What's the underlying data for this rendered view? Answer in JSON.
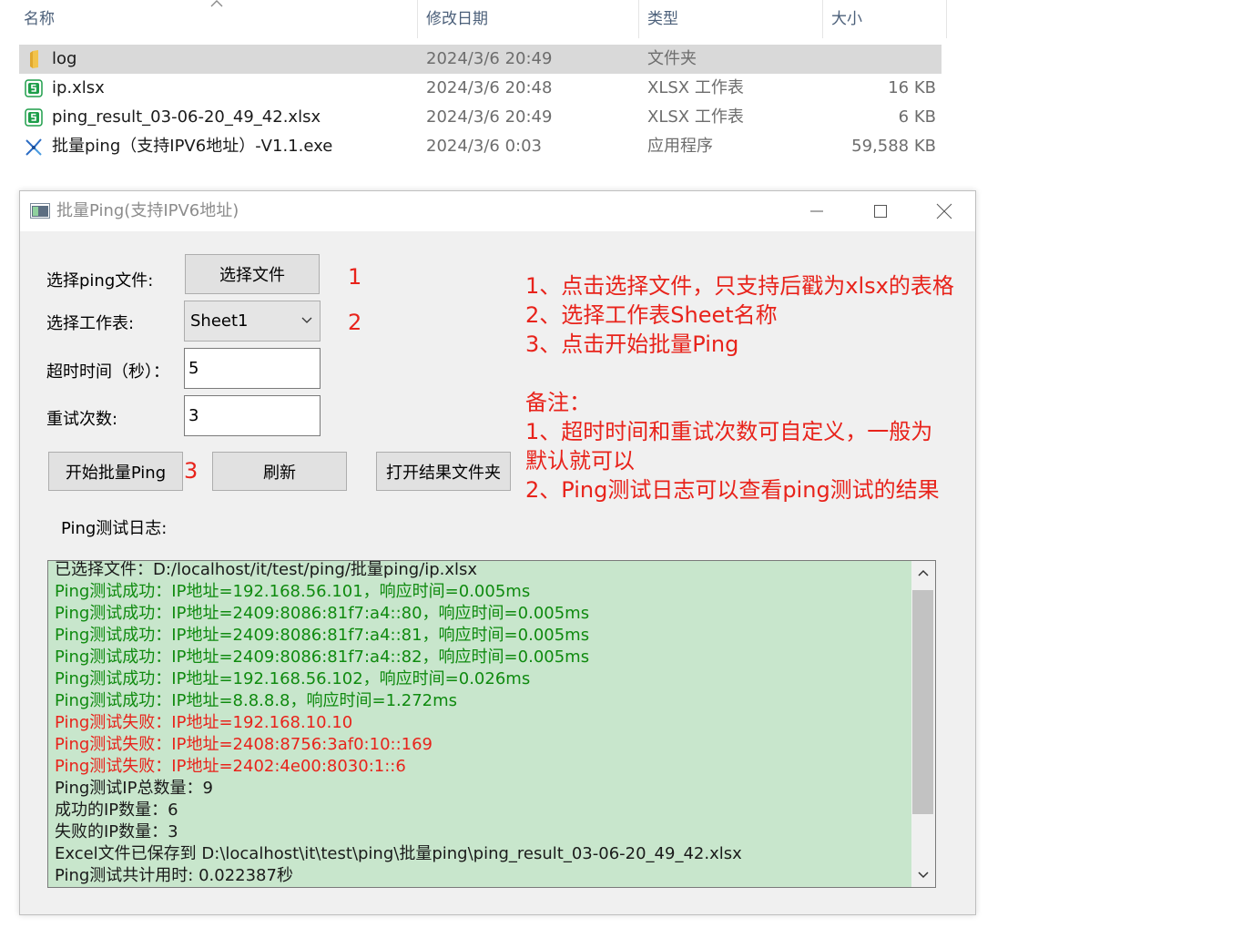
{
  "explorer": {
    "columns": {
      "name": "名称",
      "date": "修改日期",
      "type": "类型",
      "size": "大小"
    },
    "files": [
      {
        "icon": "folder-icon",
        "name": "log",
        "date": "2024/3/6 20:49",
        "type": "文件夹",
        "size": "",
        "selected": true
      },
      {
        "icon": "spreadsheet-icon",
        "name": "ip.xlsx",
        "date": "2024/3/6 20:48",
        "type": "XLSX 工作表",
        "size": "16 KB"
      },
      {
        "icon": "spreadsheet-icon",
        "name": "ping_result_03-06-20_49_42.xlsx",
        "date": "2024/3/6 20:49",
        "type": "XLSX 工作表",
        "size": "6 KB"
      },
      {
        "icon": "exe-icon",
        "name": "批量ping（支持IPV6地址）-V1.1.exe",
        "date": "2024/3/6 0:03",
        "type": "应用程序",
        "size": "59,588 KB"
      }
    ]
  },
  "window": {
    "title": "批量Ping(支持IPV6地址)",
    "select_file_label": "选择ping文件:",
    "select_file_button": "选择文件",
    "select_sheet_label": "选择工作表:",
    "sheet_value": "Sheet1",
    "timeout_label": "超时时间（秒）：",
    "timeout_value": "5",
    "retry_label": "重试次数:",
    "retry_value": "3",
    "start_button": "开始批量Ping",
    "refresh_button": "刷新",
    "open_folder_button": "打开结果文件夹",
    "log_label": "Ping测试日志:",
    "step_numbers": [
      "1",
      "2",
      "3"
    ]
  },
  "notes": [
    "1、点击选择文件，只支持后戳为xlsx的表格",
    "2、选择工作表Sheet名称",
    "3、点击开始批量Ping",
    "",
    "备注：",
    "1、超时时间和重试次数可自定义，一般为",
    "默认就可以",
    "2、Ping测试日志可以查看ping测试的结果"
  ],
  "log": [
    {
      "text": "已选择文件：D:/localhost/it/test/ping/批量ping/ip.xlsx",
      "status": "info"
    },
    {
      "text": "Ping测试成功：IP地址=192.168.56.101，响应时间=0.005ms",
      "status": "success"
    },
    {
      "text": "Ping测试成功：IP地址=2409:8086:81f7:a4::80，响应时间=0.005ms",
      "status": "success"
    },
    {
      "text": "Ping测试成功：IP地址=2409:8086:81f7:a4::81，响应时间=0.005ms",
      "status": "success"
    },
    {
      "text": "Ping测试成功：IP地址=2409:8086:81f7:a4::82，响应时间=0.005ms",
      "status": "success"
    },
    {
      "text": "Ping测试成功：IP地址=192.168.56.102，响应时间=0.026ms",
      "status": "success"
    },
    {
      "text": "Ping测试成功：IP地址=8.8.8.8，响应时间=1.272ms",
      "status": "success"
    },
    {
      "text": "Ping测试失败：IP地址=192.168.10.10",
      "status": "fail"
    },
    {
      "text": "Ping测试失败：IP地址=2408:8756:3af0:10::169",
      "status": "fail"
    },
    {
      "text": "Ping测试失败：IP地址=2402:4e00:8030:1::6",
      "status": "fail"
    },
    {
      "text": "Ping测试IP总数量：9",
      "status": "info"
    },
    {
      "text": "成功的IP数量：6",
      "status": "info"
    },
    {
      "text": "失败的IP数量：3",
      "status": "info"
    },
    {
      "text": "Excel文件已保存到 D:\\localhost\\it\\test\\ping\\批量ping\\ping_result_03-06-20_49_42.xlsx",
      "status": "info"
    },
    {
      "text": "Ping测试共计用时: 0.022387秒",
      "status": "info"
    }
  ],
  "colors": {
    "accent_red": "#e8231b",
    "success_green": "#0f8a0f",
    "log_background": "#c8e6cc"
  }
}
